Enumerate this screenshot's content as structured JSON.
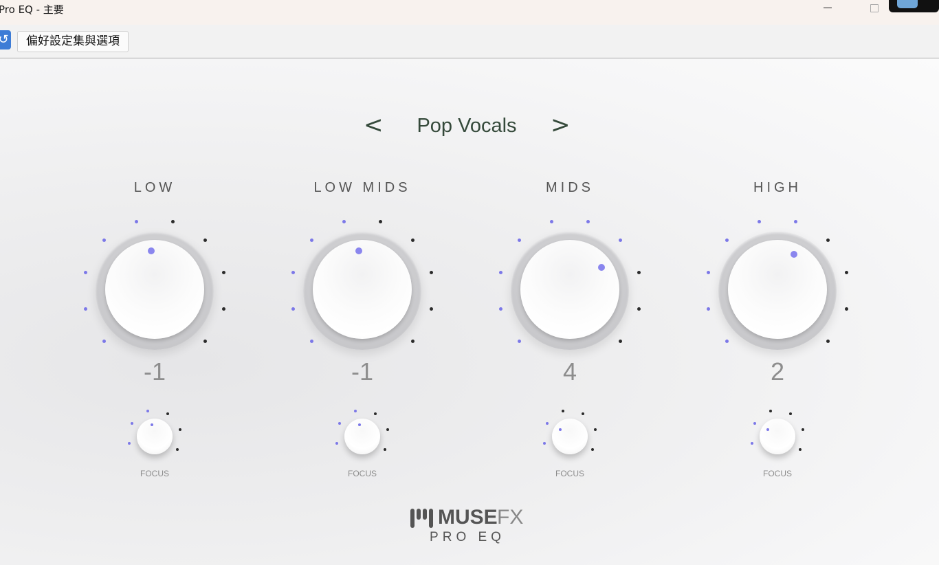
{
  "window": {
    "title": "Pro EQ - 主要"
  },
  "toolbar": {
    "app_icon_glyph": "↺",
    "preferences_label": "偏好設定集與選項"
  },
  "preset": {
    "prev_glyph": "<",
    "next_glyph": ">",
    "name": "Pop Vocals"
  },
  "bands": [
    {
      "label": "LOW",
      "value": "-1",
      "focus_label": "FOCUS",
      "knob_lit_ticks": 5,
      "focus_lit_ticks": 3
    },
    {
      "label": "LOW MIDS",
      "value": "-1",
      "focus_label": "FOCUS",
      "knob_lit_ticks": 5,
      "focus_lit_ticks": 3
    },
    {
      "label": "MIDS",
      "value": "4",
      "focus_label": "FOCUS",
      "knob_lit_ticks": 7,
      "focus_lit_ticks": 2
    },
    {
      "label": "HIGH",
      "value": "2",
      "focus_label": "FOCUS",
      "knob_lit_ticks": 6,
      "focus_lit_ticks": 2
    }
  ],
  "logo": {
    "brand_bold": "MUSE",
    "brand_light": "FX",
    "product": "PRO EQ"
  },
  "colors": {
    "accent": "#7c78e8",
    "preset_text": "#34493a",
    "value_text": "#8d8d8d"
  },
  "icons": {
    "app": "refresh-icon",
    "minimize": "minimize-icon",
    "maximize": "maximize-icon",
    "logo": "musefx-logo-icon"
  }
}
